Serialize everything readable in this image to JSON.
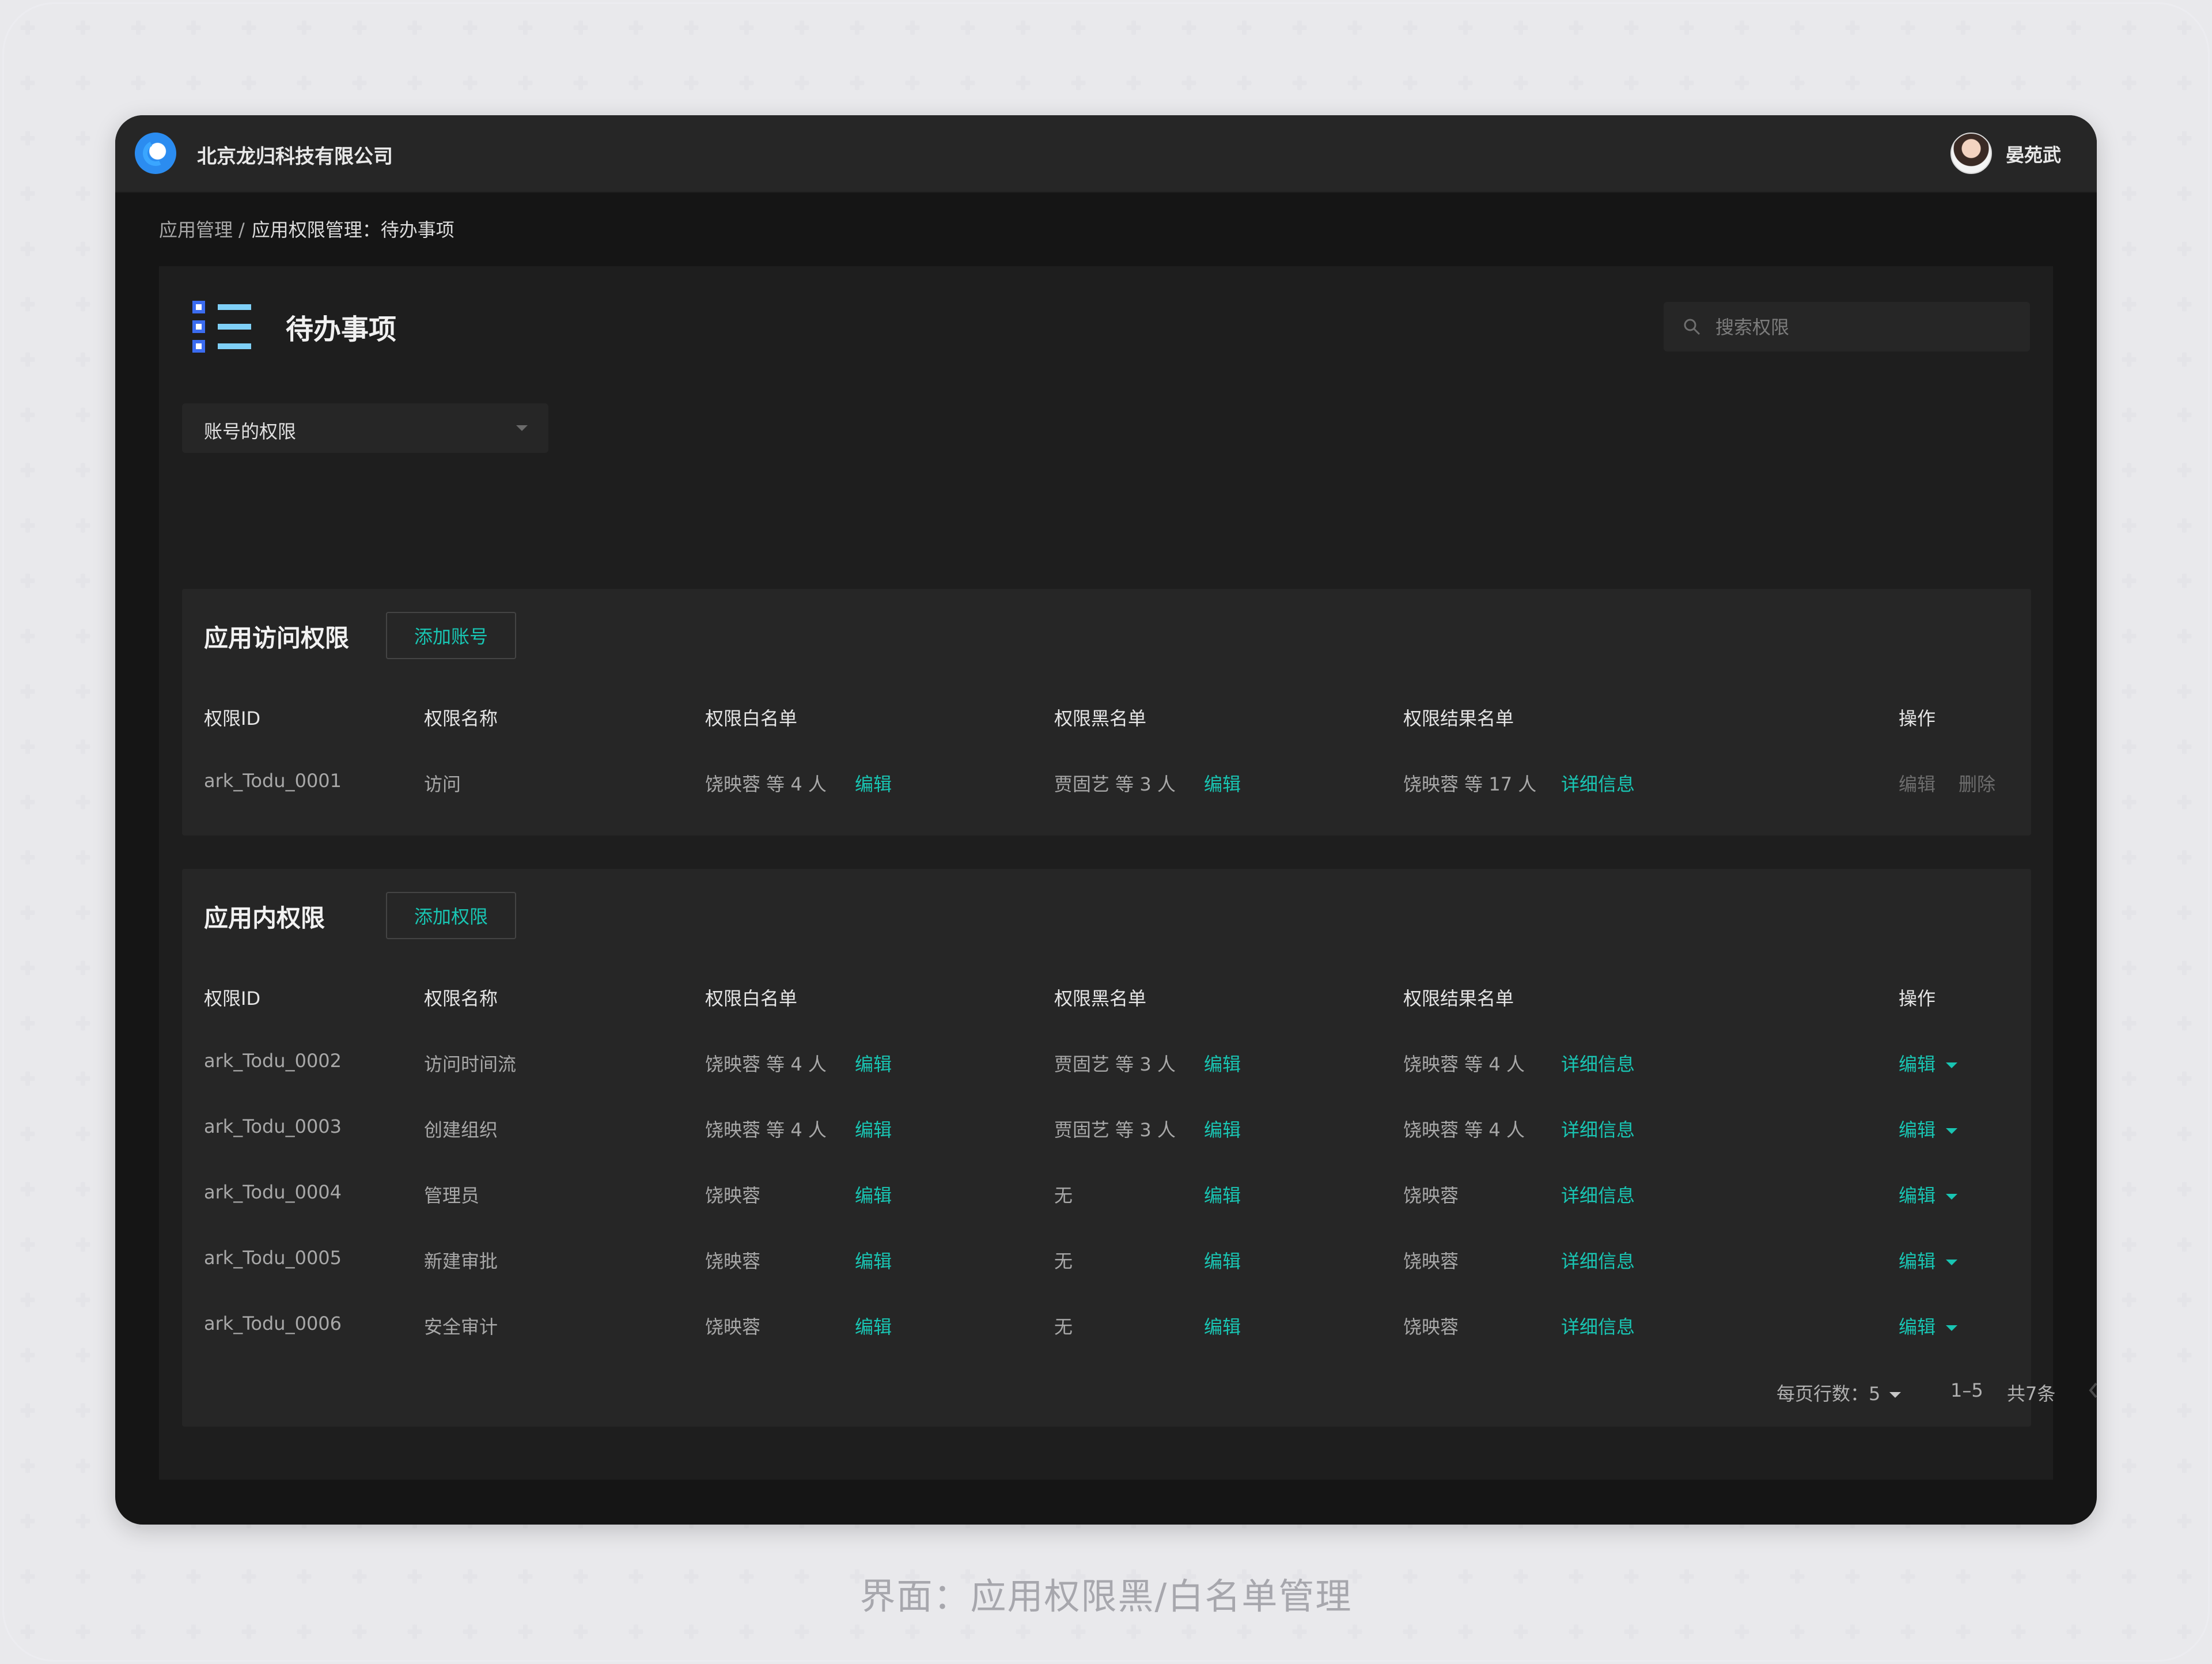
{
  "header": {
    "company": "北京龙归科技有限公司",
    "user": "晏苑武"
  },
  "breadcrumb": {
    "items": [
      "应用管理",
      "应用权限管理：待办事项"
    ],
    "separator": "/"
  },
  "page": {
    "title": "待办事项",
    "search_placeholder": "搜索权限",
    "filter_value": "账号的权限"
  },
  "columns": [
    "权限ID",
    "权限名称",
    "权限白名单",
    "权限黑名单",
    "权限结果名单",
    "操作"
  ],
  "access_section": {
    "title": "应用访问权限",
    "add_button": "添加账号",
    "rows": [
      {
        "id": "ark_Todu_0001",
        "name": "访问",
        "whitelist": "饶映蓉 等 4 人",
        "whitelist_action": "编辑",
        "blacklist": "贾固艺 等 3 人",
        "blacklist_action": "编辑",
        "result": "饶映蓉 等 17 人",
        "result_action": "详细信息",
        "op_edit": "编辑",
        "op_delete": "删除"
      }
    ]
  },
  "inner_section": {
    "title": "应用内权限",
    "add_button": "添加权限",
    "rows": [
      {
        "id": "ark_Todu_0002",
        "name": "访问时间流",
        "whitelist": "饶映蓉 等 4 人",
        "whitelist_action": "编辑",
        "blacklist": "贾固艺 等 3 人",
        "blacklist_action": "编辑",
        "result": "饶映蓉 等 4 人",
        "result_action": "详细信息",
        "op": "编辑"
      },
      {
        "id": "ark_Todu_0003",
        "name": "创建组织",
        "whitelist": "饶映蓉 等 4 人",
        "whitelist_action": "编辑",
        "blacklist": "贾固艺 等 3 人",
        "blacklist_action": "编辑",
        "result": "饶映蓉 等 4 人",
        "result_action": "详细信息",
        "op": "编辑"
      },
      {
        "id": "ark_Todu_0004",
        "name": "管理员",
        "whitelist": "饶映蓉",
        "whitelist_action": "编辑",
        "blacklist": "无",
        "blacklist_action": "编辑",
        "result": "饶映蓉",
        "result_action": "详细信息",
        "op": "编辑"
      },
      {
        "id": "ark_Todu_0005",
        "name": "新建审批",
        "whitelist": "饶映蓉",
        "whitelist_action": "编辑",
        "blacklist": "无",
        "blacklist_action": "编辑",
        "result": "饶映蓉",
        "result_action": "详细信息",
        "op": "编辑"
      },
      {
        "id": "ark_Todu_0006",
        "name": "安全审计",
        "whitelist": "饶映蓉",
        "whitelist_action": "编辑",
        "blacklist": "无",
        "blacklist_action": "编辑",
        "result": "饶映蓉",
        "result_action": "详细信息",
        "op": "编辑"
      }
    ]
  },
  "pagination": {
    "per_page_label": "每页行数：5",
    "range": "1–5",
    "total": "共7条"
  },
  "caption": "界面：应用权限黑/白名单管理",
  "colors": {
    "accent": "#19c5b3",
    "background": "#151515",
    "card": "#262626",
    "topbar": "#262626"
  },
  "icons": {
    "logo": "company-logo",
    "page": "list-icon",
    "search": "search-icon",
    "prev": "chevron-left-icon",
    "next": "chevron-right-icon"
  }
}
